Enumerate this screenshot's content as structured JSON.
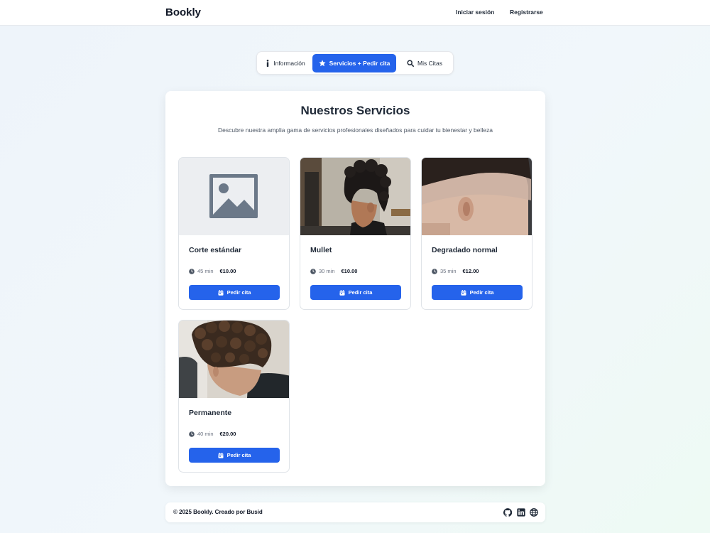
{
  "header": {
    "brand": "Bookly",
    "login_label": "Iniciar sesión",
    "register_label": "Registrarse"
  },
  "tabs": [
    {
      "label": "Información",
      "icon": "info-icon",
      "active": false
    },
    {
      "label": "Servicios + Pedir cita",
      "icon": "star-icon",
      "active": true
    },
    {
      "label": "Mis Citas",
      "icon": "search-icon",
      "active": false
    }
  ],
  "main": {
    "title": "Nuestros Servicios",
    "subtitle": "Descubre nuestra amplia gama de servicios profesionales diseñados para cuidar tu bienestar y belleza"
  },
  "services": [
    {
      "name": "Corte estándar",
      "duration": "45 min",
      "price": "€10.00",
      "button": "Pedir cita",
      "image": "image-placeholder-icon"
    },
    {
      "name": "Mullet",
      "duration": "30 min",
      "price": "€10.00",
      "button": "Pedir cita",
      "image": "mullet-haircut-photo"
    },
    {
      "name": "Degradado normal",
      "duration": "35 min",
      "price": "€12.00",
      "button": "Pedir cita",
      "image": "fade-haircut-photo"
    },
    {
      "name": "Permanente",
      "duration": "40 min",
      "price": "€20.00",
      "button": "Pedir cita",
      "image": "perm-haircut-photo"
    }
  ],
  "footer": {
    "text": "© 2025 Bookly. Creado por Busid",
    "icons": [
      "github-icon",
      "linkedin-icon",
      "globe-icon"
    ]
  },
  "colors": {
    "accent": "#2563eb",
    "text": "#1f2937",
    "muted": "#6b7280"
  }
}
